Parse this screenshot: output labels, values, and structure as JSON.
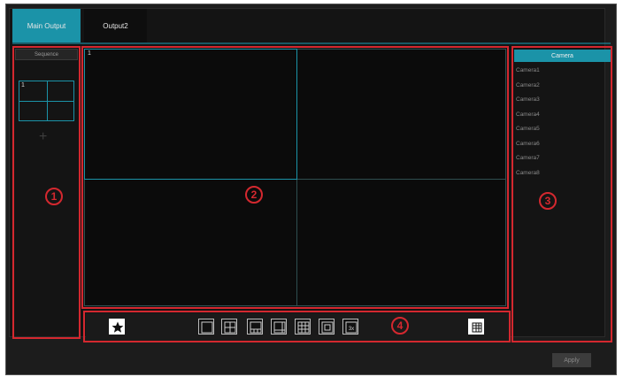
{
  "tabs": [
    {
      "label": "Main Output",
      "active": true
    },
    {
      "label": "Output2",
      "active": false
    }
  ],
  "sequence": {
    "header": "Sequence",
    "thumb_number": "1",
    "add_symbol": "+"
  },
  "video": {
    "selected_cell_number": "1",
    "layout": "2x2"
  },
  "cameras": {
    "header": "Camera",
    "items": [
      "Camera1",
      "Camera2",
      "Camera3",
      "Camera4",
      "Camera5",
      "Camera6",
      "Camera7",
      "Camera8"
    ]
  },
  "toolbar": {
    "icons": [
      "favorite-star-icon",
      "layout-1-icon",
      "layout-4-icon",
      "layout-6-icon",
      "layout-8-icon",
      "layout-9-icon",
      "layout-13-icon",
      "layout-16-icon",
      "list-icon"
    ]
  },
  "callouts": [
    "1",
    "2",
    "3",
    "4"
  ],
  "footer": {
    "apply_label": "Apply"
  },
  "colors": {
    "accent": "#1b93a8",
    "callout_red": "#d4282f",
    "background": "#141414"
  }
}
